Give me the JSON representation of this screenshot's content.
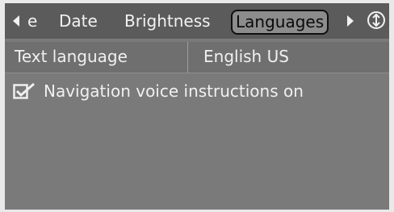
{
  "tabs": {
    "partial_label": "e",
    "date_label": "Date",
    "brightness_label": "Brightness",
    "languages_label": "Languages",
    "active": "Languages"
  },
  "icons": {
    "prev": "chevron-left-icon",
    "next": "chevron-right-icon",
    "settings": "settings-dial-icon",
    "checkbox": "checkbox-checked-icon"
  },
  "settings": {
    "text_language": {
      "label": "Text language",
      "value": "English US"
    },
    "navigation_voice": {
      "label": "Navigation voice instructions on",
      "checked": true
    }
  },
  "colors": {
    "background": "#7a7a7a",
    "tabbar": "#5b5b5b",
    "text": "#f0f0f0",
    "active_tab_border": "#101010"
  }
}
